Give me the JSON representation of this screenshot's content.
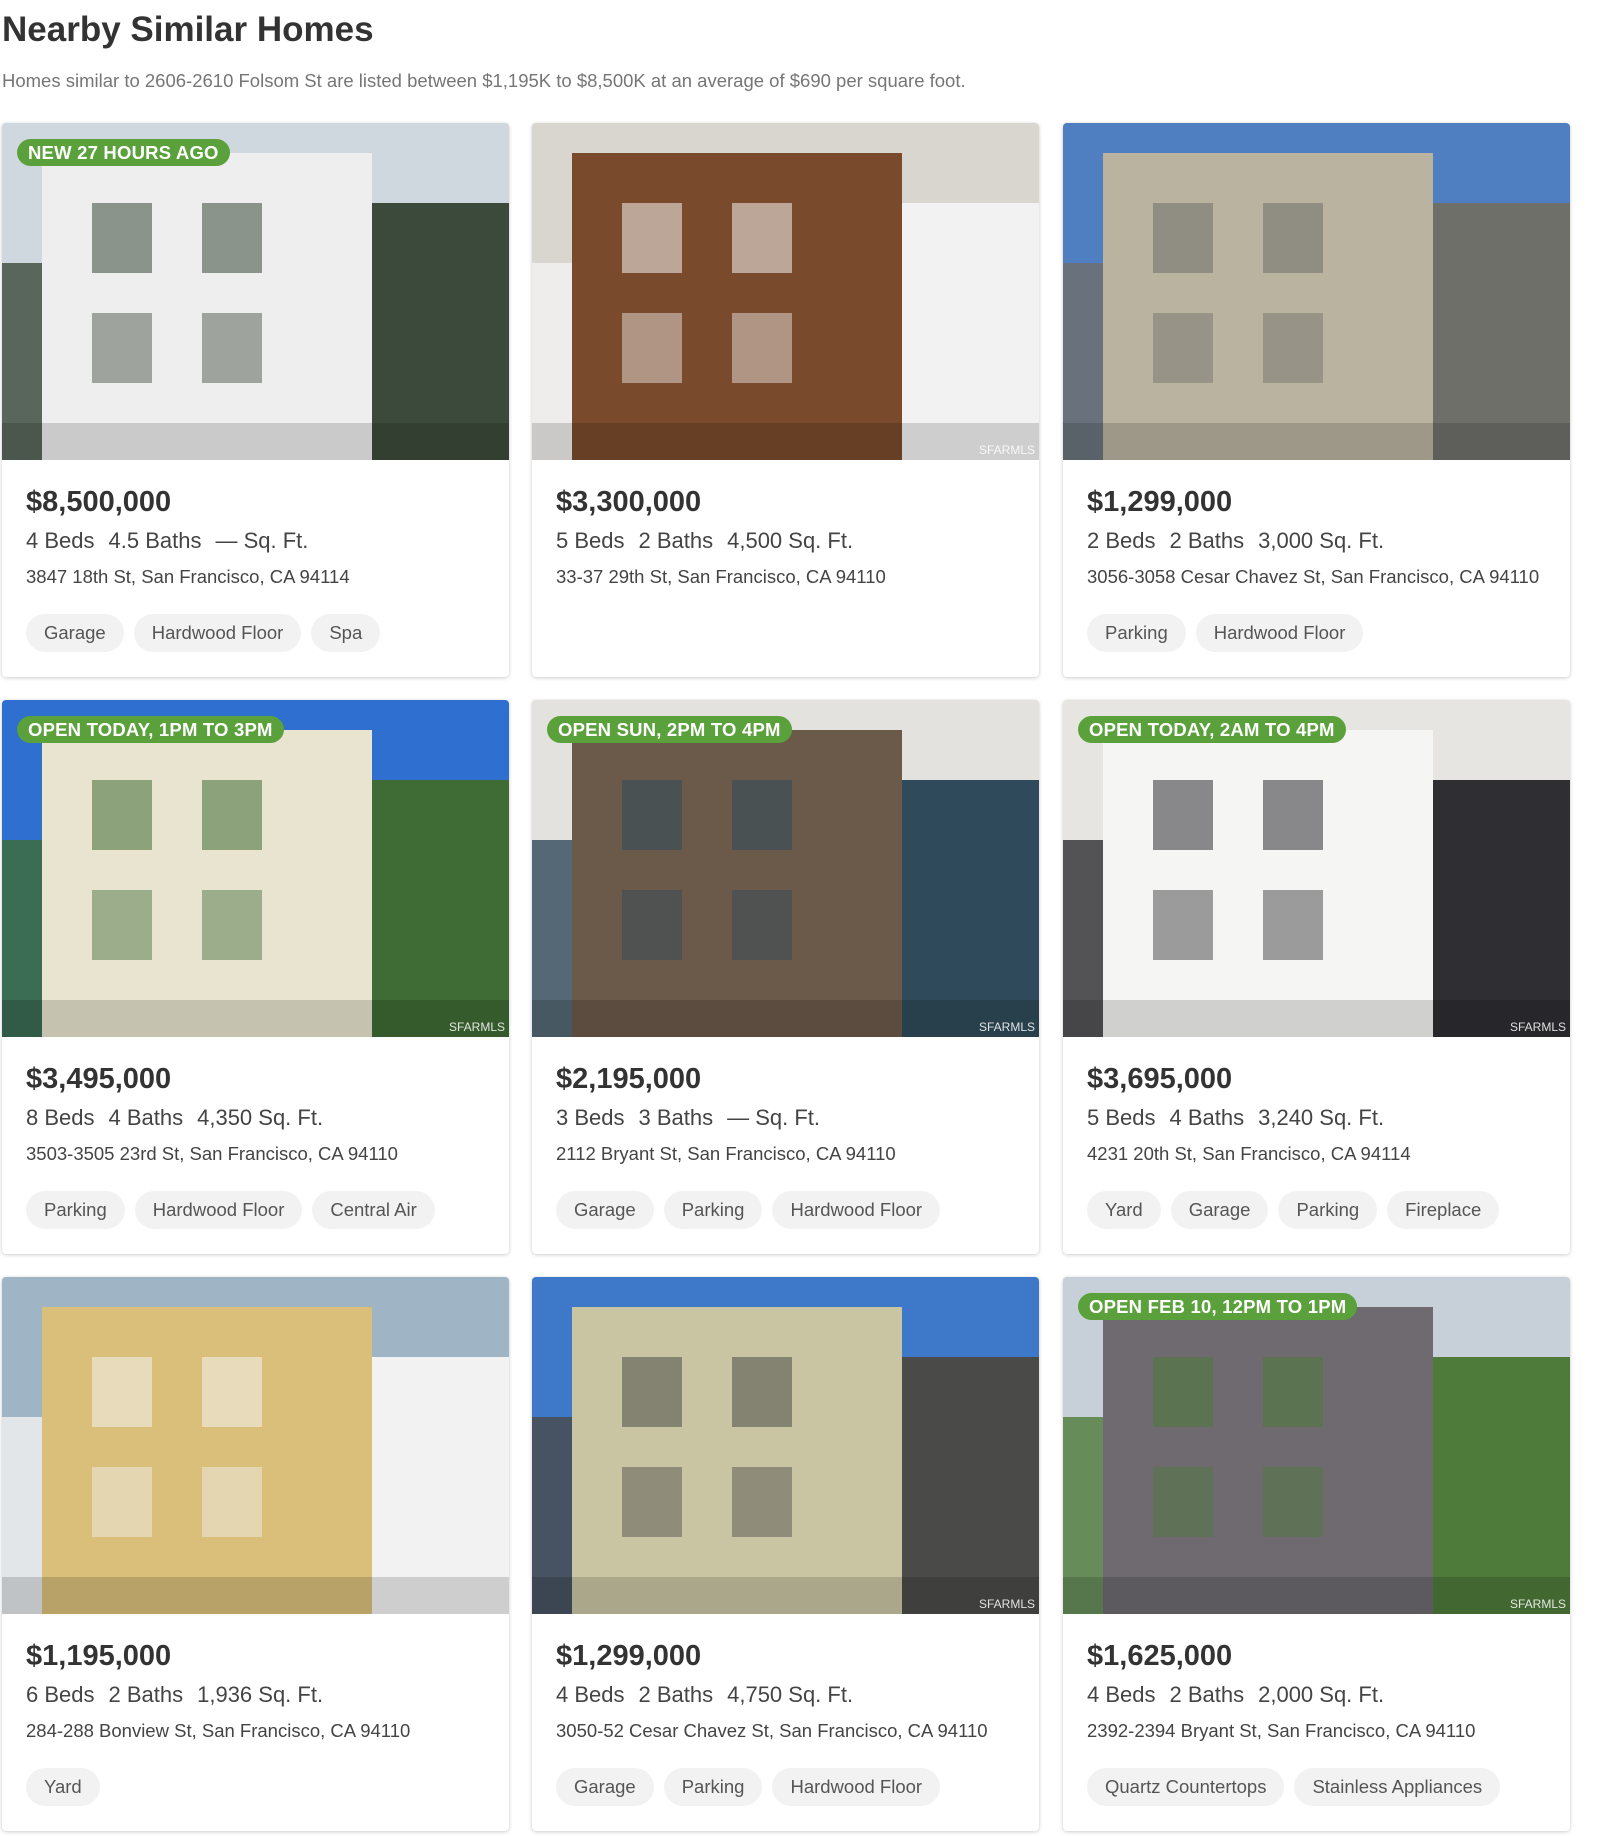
{
  "section": {
    "title": "Nearby Similar Homes",
    "subtitle": "Homes similar to 2606-2610 Folsom St are listed between $1,195K to $8,500K at an average of $690 per square foot."
  },
  "listings": [
    {
      "badge": "NEW 27 HOURS AGO",
      "price": "$8,500,000",
      "beds": "4 Beds",
      "baths": "4.5 Baths",
      "sqft": "— Sq. Ft.",
      "address": "3847 18th St, San Francisco, CA 94114",
      "tags": [
        "Garage",
        "Hardwood Floor",
        "Spa"
      ],
      "watermark": "",
      "photo_colors": {
        "sky": "#cfd8de",
        "main": "#eeeeee",
        "accent": "#3b4a3a"
      }
    },
    {
      "badge": "",
      "price": "$3,300,000",
      "beds": "5 Beds",
      "baths": "2 Baths",
      "sqft": "4,500 Sq. Ft.",
      "address": "33-37 29th St, San Francisco, CA 94110",
      "tags": [],
      "watermark": "SFARMLS",
      "photo_colors": {
        "sky": "#d9d6d0",
        "main": "#7a4a2c",
        "accent": "#f2f2f2"
      }
    },
    {
      "badge": "",
      "price": "$1,299,000",
      "beds": "2 Beds",
      "baths": "2 Baths",
      "sqft": "3,000 Sq. Ft.",
      "address": "3056-3058 Cesar Chavez St, San Francisco, CA 94110",
      "tags": [
        "Parking",
        "Hardwood Floor"
      ],
      "watermark": "",
      "photo_colors": {
        "sky": "#4f7fc0",
        "main": "#b9b39f",
        "accent": "#6f6f6a"
      }
    },
    {
      "badge": "OPEN TODAY, 1PM TO 3PM",
      "price": "$3,495,000",
      "beds": "8 Beds",
      "baths": "4 Baths",
      "sqft": "4,350 Sq. Ft.",
      "address": "3503-3505 23rd St, San Francisco, CA 94110",
      "tags": [
        "Parking",
        "Hardwood Floor",
        "Central Air"
      ],
      "watermark": "SFARMLS",
      "photo_colors": {
        "sky": "#2f6fd0",
        "main": "#e8e4cf",
        "accent": "#3f6b35"
      }
    },
    {
      "badge": "OPEN SUN, 2PM TO 4PM",
      "price": "$2,195,000",
      "beds": "3 Beds",
      "baths": "3 Baths",
      "sqft": "— Sq. Ft.",
      "address": "2112 Bryant St, San Francisco, CA 94110",
      "tags": [
        "Garage",
        "Parking",
        "Hardwood Floor"
      ],
      "watermark": "SFARMLS",
      "photo_colors": {
        "sky": "#e4e2de",
        "main": "#6b5a4a",
        "accent": "#2f4a5a"
      }
    },
    {
      "badge": "OPEN TODAY, 2AM TO 4PM",
      "price": "$3,695,000",
      "beds": "5 Beds",
      "baths": "4 Baths",
      "sqft": "3,240 Sq. Ft.",
      "address": "4231 20th St, San Francisco, CA 94114",
      "tags": [
        "Yard",
        "Garage",
        "Parking",
        "Fireplace"
      ],
      "watermark": "SFARMLS",
      "photo_colors": {
        "sky": "#e7e5e1",
        "main": "#f5f5f3",
        "accent": "#2e2e33"
      }
    },
    {
      "badge": "",
      "price": "$1,195,000",
      "beds": "6 Beds",
      "baths": "2 Baths",
      "sqft": "1,936 Sq. Ft.",
      "address": "284-288 Bonview St, San Francisco, CA 94110",
      "tags": [
        "Yard"
      ],
      "watermark": "",
      "photo_colors": {
        "sky": "#9fb4c4",
        "main": "#d9bf7a",
        "accent": "#f2f2f2"
      }
    },
    {
      "badge": "",
      "price": "$1,299,000",
      "beds": "4 Beds",
      "baths": "2 Baths",
      "sqft": "4,750 Sq. Ft.",
      "address": "3050-52 Cesar Chavez St, San Francisco, CA 94110",
      "tags": [
        "Garage",
        "Parking",
        "Hardwood Floor"
      ],
      "watermark": "SFARMLS",
      "photo_colors": {
        "sky": "#3e78c8",
        "main": "#c9c5a3",
        "accent": "#4a4a48"
      }
    },
    {
      "badge": "OPEN FEB 10, 12PM TO 1PM",
      "price": "$1,625,000",
      "beds": "4 Beds",
      "baths": "2 Baths",
      "sqft": "2,000 Sq. Ft.",
      "address": "2392-2394 Bryant St, San Francisco, CA 94110",
      "tags": [
        "Quartz Countertops",
        "Stainless Appliances"
      ],
      "watermark": "SFARMLS",
      "photo_colors": {
        "sky": "#c7d0d8",
        "main": "#6e6a70",
        "accent": "#4e7a3a"
      }
    }
  ]
}
